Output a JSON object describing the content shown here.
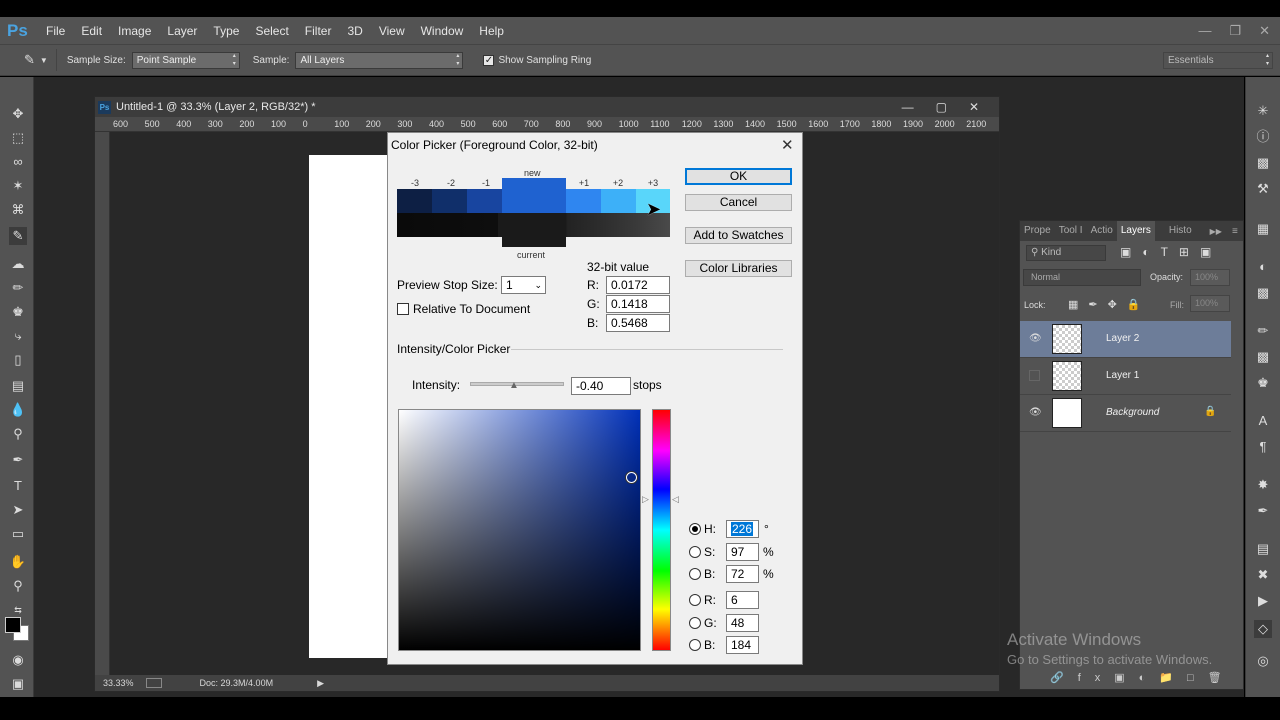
{
  "app": {
    "logo": "Ps",
    "menu": [
      "File",
      "Edit",
      "Image",
      "Layer",
      "Type",
      "Select",
      "Filter",
      "3D",
      "View",
      "Window",
      "Help"
    ]
  },
  "options_bar": {
    "sample_size_label": "Sample Size:",
    "sample_size_value": "Point Sample",
    "sample_label": "Sample:",
    "sample_value": "All Layers",
    "show_ring_label": "Show Sampling Ring",
    "show_ring_checked": true,
    "workspace": "Essentials"
  },
  "document": {
    "title": "Untitled-1 @ 33.3% (Layer 2, RGB/32*) *",
    "ruler_ticks": [
      "600",
      "500",
      "400",
      "300",
      "200",
      "100",
      "0",
      "100",
      "200",
      "300",
      "400",
      "500",
      "600",
      "700",
      "800",
      "900",
      "1000",
      "1100",
      "1200",
      "1300",
      "1400",
      "1500",
      "1600",
      "1700",
      "1800",
      "1900",
      "2000",
      "2100"
    ],
    "zoom": "33.33%",
    "doc_info": "Doc: 29.3M/4.00M"
  },
  "layers_panel": {
    "tabs": [
      "Prope",
      "Tool I",
      "Actio",
      "Layers",
      "Histo"
    ],
    "active_tab": "Layers",
    "kind_label": "Kind",
    "blend_mode": "Normal",
    "opacity_label": "Opacity:",
    "opacity_value": "100%",
    "lock_label": "Lock:",
    "fill_label": "Fill:",
    "fill_value": "100%",
    "layers": [
      {
        "name": "Layer 2",
        "visible": true,
        "selected": true
      },
      {
        "name": "Layer 1",
        "visible": false,
        "selected": false
      },
      {
        "name": "Background",
        "visible": true,
        "selected": false,
        "locked": true
      }
    ]
  },
  "color_picker": {
    "title": "Color Picker (Foreground Color, 32-bit)",
    "new_label": "new",
    "current_label": "current",
    "stop_labels": [
      "-3",
      "-2",
      "-1",
      "+1",
      "+2",
      "+3"
    ],
    "buttons": {
      "ok": "OK",
      "cancel": "Cancel",
      "add_swatches": "Add to Swatches",
      "libraries": "Color Libraries"
    },
    "preview_stop_label": "Preview Stop Size:",
    "preview_stop_value": "1",
    "relative_label": "Relative To Document",
    "bit32_label": "32-bit value",
    "bit32": {
      "R": "0.0172",
      "G": "0.1418",
      "B": "0.5468"
    },
    "section_label": "Intensity/Color Picker",
    "intensity_label": "Intensity:",
    "intensity_value": "-0.40",
    "intensity_unit": "stops",
    "hsb": {
      "H": "226",
      "S": "97",
      "B": "72"
    },
    "rgb": {
      "R": "6",
      "G": "48",
      "B": "184"
    },
    "units": {
      "deg": "°",
      "pct": "%"
    },
    "colors": {
      "new": "#1f62d0",
      "current": "#1a1a1a",
      "hue_field": "#0030b8"
    }
  },
  "watermark": {
    "line1": "Activate Windows",
    "line2": "Go to Settings to activate Windows."
  }
}
